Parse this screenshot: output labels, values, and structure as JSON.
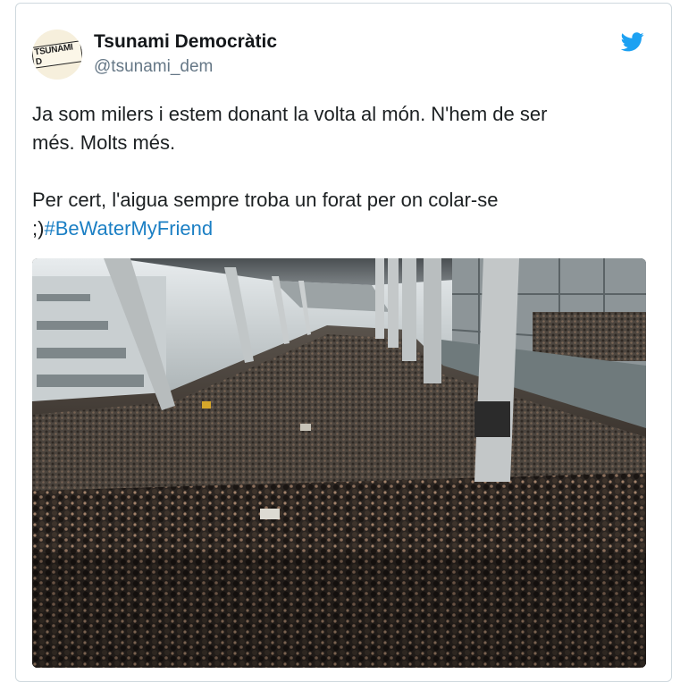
{
  "tweet": {
    "author_name": "Tsunami Democràtic",
    "author_handle": "@tsunami_dem",
    "avatar_text": "TSUNAMI D",
    "line1": "Ja som milers i estem donant la volta al món. N'hem de ser",
    "line2": "més. Molts més.",
    "line3": "Per cert, l'aigua sempre troba un forat per on colar-se",
    "line4_prefix": ";)",
    "hashtag": "#BeWaterMyFriend",
    "image_alt": "",
    "brand_icon": "twitter-bird-icon",
    "brand_color": "#1da1f2",
    "link_color": "#1b7fc4"
  }
}
